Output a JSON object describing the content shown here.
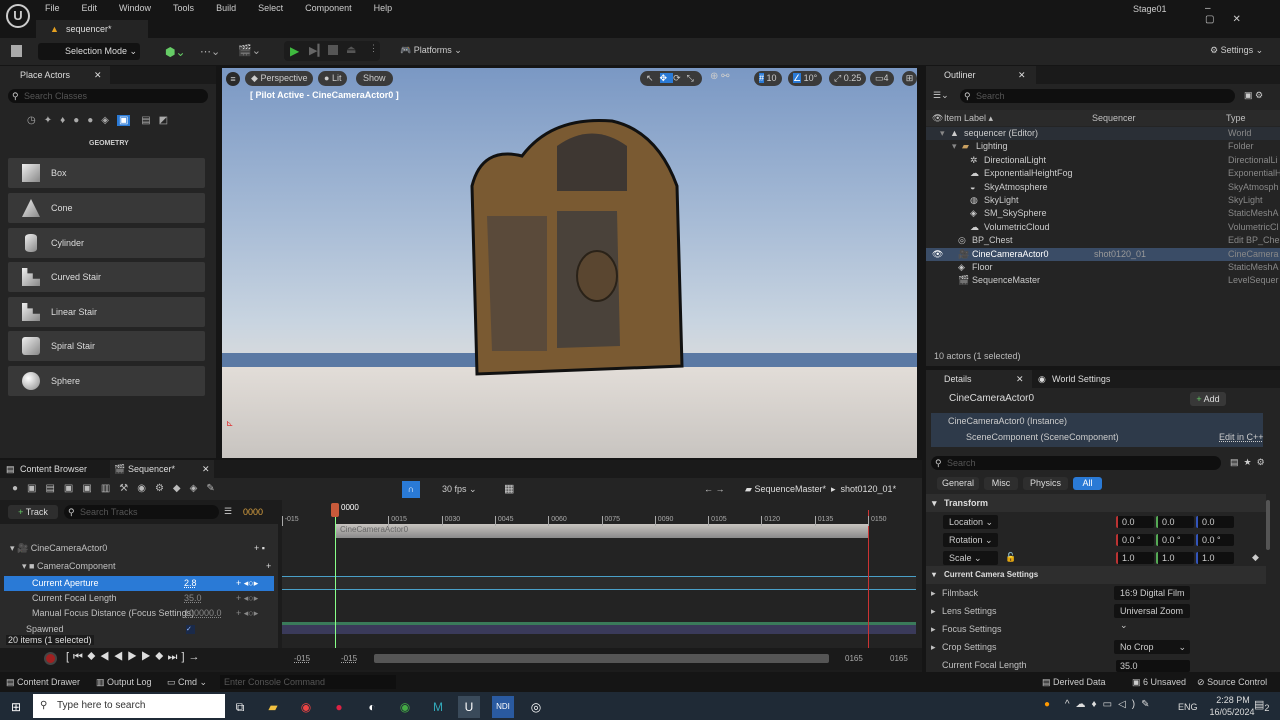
{
  "menu": [
    "File",
    "Edit",
    "Window",
    "Tools",
    "Build",
    "Select",
    "Component",
    "Help"
  ],
  "project_tab": "sequencer*",
  "stage": "Stage01",
  "toolbar": {
    "selection_mode": "Selection Mode",
    "platforms": "Platforms",
    "settings": "Settings"
  },
  "place_actors": {
    "title": "Place Actors",
    "search_placeholder": "Search Classes",
    "category": "GEOMETRY",
    "items": [
      "Box",
      "Cone",
      "Cylinder",
      "Curved Stair",
      "Linear Stair",
      "Spiral Stair",
      "Sphere"
    ]
  },
  "viewport": {
    "perspective": "Perspective",
    "lit": "Lit",
    "show": "Show",
    "pilot": "[ Pilot Active - CineCameraActor0 ]",
    "grid": "10",
    "angle": "10°",
    "scale": "0.25",
    "camera_speed": "4"
  },
  "outliner": {
    "title": "Outliner",
    "search_placeholder": "Search",
    "col_label": "Item Label",
    "col_seq": "Sequencer",
    "col_type": "Type",
    "rows": [
      {
        "label": "sequencer (Editor)",
        "type": "World",
        "seq": ""
      },
      {
        "label": "Lighting",
        "type": "Folder",
        "seq": ""
      },
      {
        "label": "DirectionalLight",
        "type": "DirectionalLi",
        "seq": ""
      },
      {
        "label": "ExponentialHeightFog",
        "type": "ExponentialH",
        "seq": ""
      },
      {
        "label": "SkyAtmosphere",
        "type": "SkyAtmosph",
        "seq": ""
      },
      {
        "label": "SkyLight",
        "type": "SkyLight",
        "seq": ""
      },
      {
        "label": "SM_SkySphere",
        "type": "StaticMeshA",
        "seq": ""
      },
      {
        "label": "VolumetricCloud",
        "type": "VolumetricCl",
        "seq": ""
      },
      {
        "label": "BP_Chest",
        "type": "Edit BP_Che",
        "seq": ""
      },
      {
        "label": "CineCameraActor0",
        "type": "CineCamera",
        "seq": "shot0120_01"
      },
      {
        "label": "Floor",
        "type": "StaticMeshA",
        "seq": ""
      },
      {
        "label": "SequenceMaster",
        "type": "LevelSequer",
        "seq": ""
      }
    ],
    "status": "10 actors (1 selected)"
  },
  "details": {
    "tab": "Details",
    "world_tab": "World Settings",
    "actor": "CineCameraActor0",
    "add": "Add",
    "instance": "CineCameraActor0 (Instance)",
    "component": "SceneComponent (SceneComponent)",
    "edit_cpp": "Edit in C++",
    "search_placeholder": "Search",
    "filters": [
      "General",
      "Misc",
      "Physics",
      "All"
    ],
    "transform": "Transform",
    "location": "Location",
    "rotation": "Rotation",
    "scale": "Scale",
    "loc": [
      "0.0",
      "0.0",
      "0.0"
    ],
    "rot": [
      "0.0 °",
      "0.0 °",
      "0.0 °"
    ],
    "scl": [
      "1.0",
      "1.0",
      "1.0"
    ],
    "camera_settings": "Current Camera Settings",
    "filmback": "Filmback",
    "filmback_val": "16:9 Digital Film",
    "lens": "Lens Settings",
    "lens_val": "Universal Zoom",
    "focus": "Focus Settings",
    "crop": "Crop Settings",
    "crop_val": "No Crop",
    "focal": "Current Focal Length",
    "focal_val": "35.0"
  },
  "sequencer": {
    "content_browser": "Content Browser",
    "tab": "Sequencer*",
    "fps": "30 fps",
    "track": "Track",
    "search_placeholder": "Search Tracks",
    "frame": "0000",
    "breadcrumb1": "SequenceMaster*",
    "breadcrumb2": "shot0120_01*",
    "actor": "CineCameraActor0",
    "component": "CameraComponent",
    "tracks": [
      {
        "name": "Current Aperture",
        "value": "2.8"
      },
      {
        "name": "Current Focal Length",
        "value": "35.0"
      },
      {
        "name": "Manual Focus Distance (Focus Settings)",
        "value": "100000.0"
      }
    ],
    "spawned": "Spawned",
    "items": "20 items (1 selected)",
    "ticks": [
      "-015",
      "0015",
      "0030",
      "0045",
      "0060",
      "0075",
      "0090",
      "0105",
      "0120",
      "0135",
      "0150"
    ],
    "section": "CineCameraActor0",
    "range_start": "-015",
    "range_start2": "-015",
    "range_end": "0165",
    "range_end2": "0165"
  },
  "statusbar": {
    "drawer": "Content Drawer",
    "output": "Output Log",
    "cmd": "Cmd",
    "console_placeholder": "Enter Console Command",
    "derived": "Derived Data",
    "unsaved": "6 Unsaved",
    "source": "Source Control"
  },
  "taskbar": {
    "search": "Type here to search",
    "lang": "ENG",
    "time": "2:28 PM",
    "date": "16/05/2024",
    "notif": "2"
  }
}
